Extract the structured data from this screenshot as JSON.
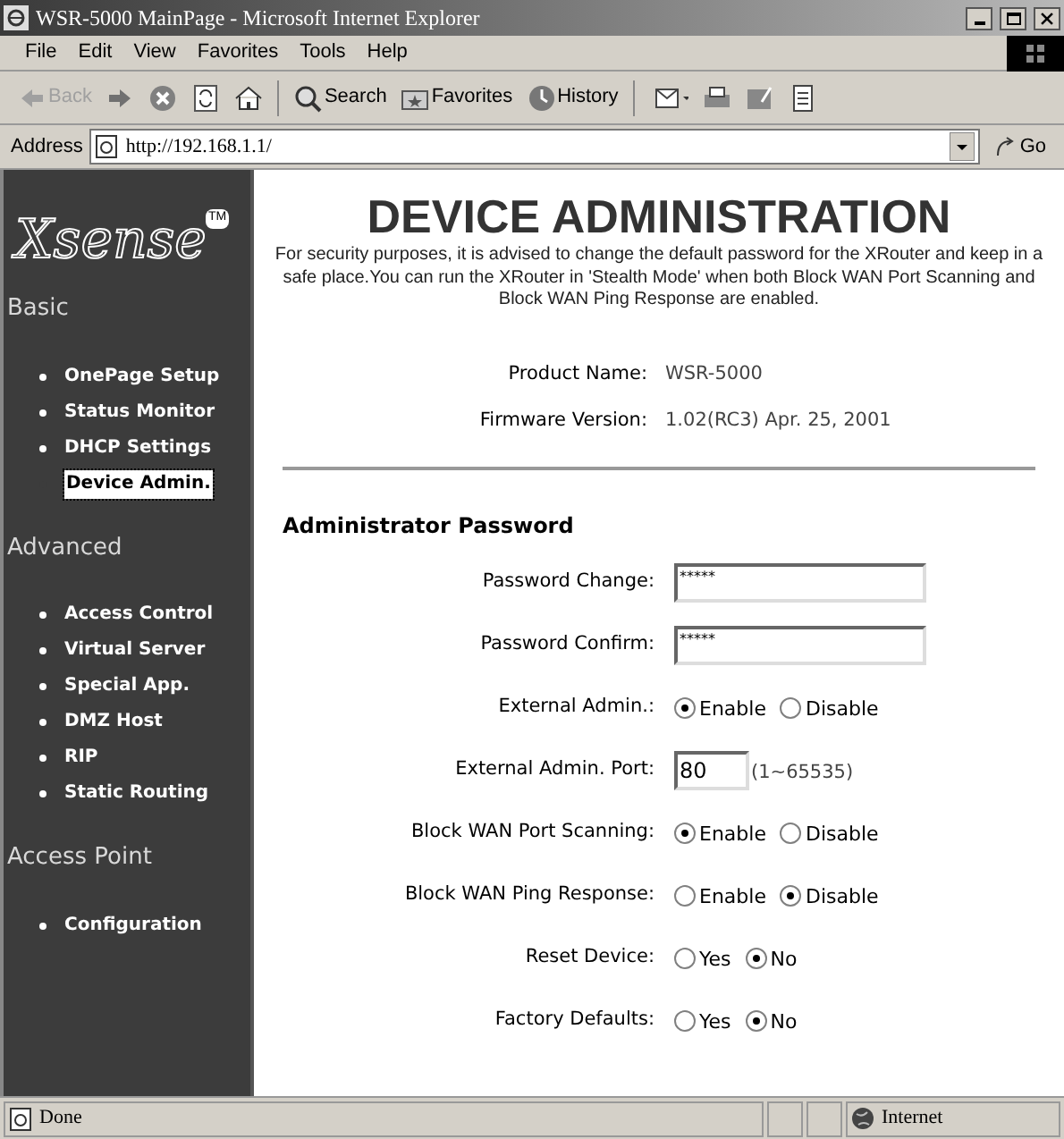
{
  "window": {
    "title": "WSR-5000 MainPage - Microsoft Internet Explorer"
  },
  "menu": [
    "File",
    "Edit",
    "View",
    "Favorites",
    "Tools",
    "Help"
  ],
  "toolbar": [
    {
      "kind": "back",
      "label": "Back",
      "disabled": true
    },
    {
      "kind": "forward",
      "disabled": false
    },
    {
      "kind": "stop"
    },
    {
      "kind": "refresh"
    },
    {
      "kind": "home"
    },
    {
      "kind": "search",
      "label": "Search"
    },
    {
      "kind": "favorites",
      "label": "Favorites"
    },
    {
      "kind": "history",
      "label": "History"
    },
    {
      "kind": "mail"
    },
    {
      "kind": "print"
    },
    {
      "kind": "edit"
    },
    {
      "kind": "discuss"
    }
  ],
  "address": {
    "label": "Address",
    "value": "http://192.168.1.1/",
    "go": "Go"
  },
  "sidebar": {
    "logo": "Xsense",
    "trademark": "TM",
    "sections": [
      {
        "title": "Basic",
        "items": [
          {
            "label": "OnePage Setup",
            "selected": false
          },
          {
            "label": "Status Monitor",
            "selected": false
          },
          {
            "label": "DHCP Settings",
            "selected": false
          },
          {
            "label": "Device Admin.",
            "selected": true
          }
        ]
      },
      {
        "title": "Advanced",
        "items": [
          {
            "label": "Access Control",
            "selected": false
          },
          {
            "label": "Virtual Server",
            "selected": false
          },
          {
            "label": "Special App.",
            "selected": false
          },
          {
            "label": "DMZ Host",
            "selected": false
          },
          {
            "label": "RIP",
            "selected": false
          },
          {
            "label": "Static Routing",
            "selected": false
          }
        ]
      },
      {
        "title": "Access Point",
        "items": [
          {
            "label": "Configuration",
            "selected": false
          }
        ]
      }
    ]
  },
  "main": {
    "title": "DEVICE ADMINISTRATION",
    "description": "For security purposes, it is advised to change the default password for the XRouter and keep in a safe place.You can run the XRouter in 'Stealth Mode' when both Block WAN Port Scanning and Block WAN Ping Response are enabled.",
    "info": [
      {
        "label": "Product Name:",
        "value": "WSR-5000"
      },
      {
        "label": "Firmware Version:",
        "value": "1.02(RC3) Apr. 25, 2001"
      }
    ],
    "section_title": "Administrator Password",
    "fields": [
      {
        "kind": "password",
        "label": "Password Change:",
        "value": "*****"
      },
      {
        "kind": "password",
        "label": "Password Confirm:",
        "value": "*****"
      },
      {
        "kind": "radio",
        "label": "External Admin.:",
        "options": [
          {
            "label": "Enable",
            "selected": true
          },
          {
            "label": "Disable",
            "selected": false
          }
        ]
      },
      {
        "kind": "port",
        "label": "External Admin. Port:",
        "value": "80",
        "hint": "(1~65535)"
      },
      {
        "kind": "radio",
        "label": "Block WAN Port Scanning:",
        "options": [
          {
            "label": "Enable",
            "selected": true
          },
          {
            "label": "Disable",
            "selected": false
          }
        ]
      },
      {
        "kind": "radio",
        "label": "Block WAN Ping Response:",
        "options": [
          {
            "label": "Enable",
            "selected": false
          },
          {
            "label": "Disable",
            "selected": true
          }
        ]
      },
      {
        "kind": "radio",
        "label": "Reset Device:",
        "options": [
          {
            "label": "Yes",
            "selected": false
          },
          {
            "label": "No",
            "selected": true
          }
        ]
      },
      {
        "kind": "radio",
        "label": "Factory Defaults:",
        "options": [
          {
            "label": "Yes",
            "selected": false
          },
          {
            "label": "No",
            "selected": true
          }
        ]
      }
    ]
  },
  "status_bar": {
    "text": "Done",
    "zone": "Internet"
  }
}
